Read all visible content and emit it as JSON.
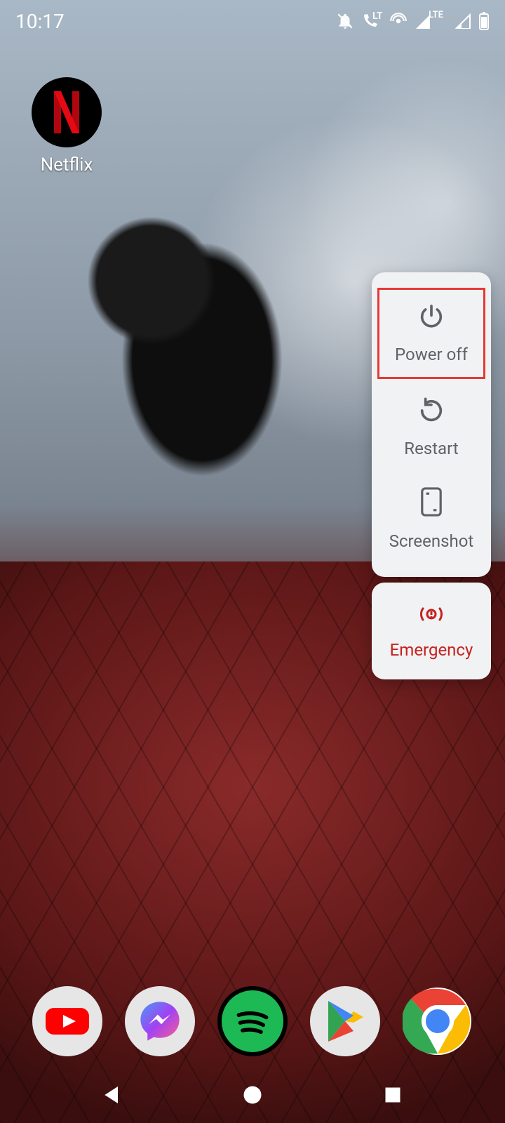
{
  "status": {
    "time": "10:17",
    "icons": {
      "dnd": "dnd-off-icon",
      "call_lte": "LTE",
      "hotspot": "hotspot-icon",
      "signal1": "LTE",
      "signal2": "signal-icon",
      "battery": "battery-icon"
    }
  },
  "home": {
    "apps": [
      {
        "name": "netflix",
        "label": "Netflix"
      }
    ]
  },
  "power_menu": {
    "items": [
      {
        "id": "power-off",
        "label": "Power off",
        "highlight": true
      },
      {
        "id": "restart",
        "label": "Restart"
      },
      {
        "id": "screenshot",
        "label": "Screenshot"
      }
    ],
    "emergency": {
      "label": "Emergency"
    }
  },
  "dock": {
    "apps": [
      {
        "id": "youtube",
        "name": "YouTube"
      },
      {
        "id": "messenger",
        "name": "Messenger"
      },
      {
        "id": "spotify",
        "name": "Spotify"
      },
      {
        "id": "play-store",
        "name": "Play Store"
      },
      {
        "id": "chrome",
        "name": "Chrome"
      }
    ]
  },
  "nav": {
    "back": "Back",
    "home": "Home",
    "recents": "Recents"
  },
  "colors": {
    "highlight_border": "#e53935",
    "emergency_text": "#c5221f",
    "menu_bg": "#f1f2f3",
    "menu_text": "#5f6368"
  }
}
